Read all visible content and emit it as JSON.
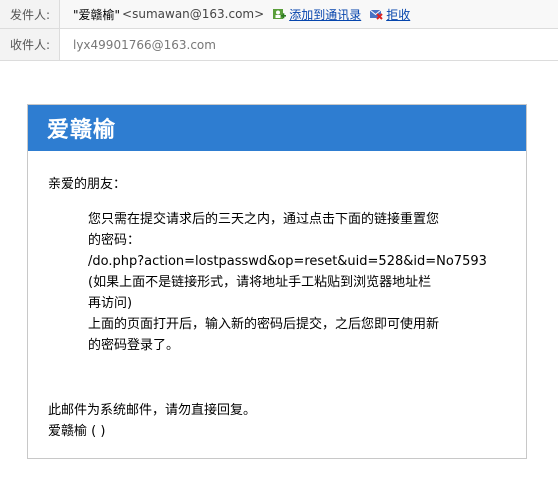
{
  "header": {
    "from_label": "发件人:",
    "from_name": "\"爱赣榆\"",
    "from_email": "<sumawan@163.com>",
    "add_contact": "添加到通讯录",
    "reject": "拒收",
    "to_label": "收件人:",
    "to_email": "lyx49901766@163.com"
  },
  "email": {
    "site_name": "爱赣榆",
    "greeting": "亲爱的朋友：",
    "body_lines": [
      "您只需在提交请求后的三天之内，通过点击下面的链接重置您",
      "的密码：",
      "/do.php?action=lostpasswd&op=reset&uid=528&id=No7593",
      "(如果上面不是链接形式，请将地址手工粘贴到浏览器地址栏",
      "再访问)",
      "上面的页面打开后，输入新的密码后提交，之后您即可使用新",
      "的密码登录了。"
    ],
    "footer_note": "此邮件为系统邮件，请勿直接回复。",
    "signature": "爱赣榆 ( )"
  },
  "colors": {
    "banner": "#2e7dd1",
    "link": "#0645ad"
  }
}
